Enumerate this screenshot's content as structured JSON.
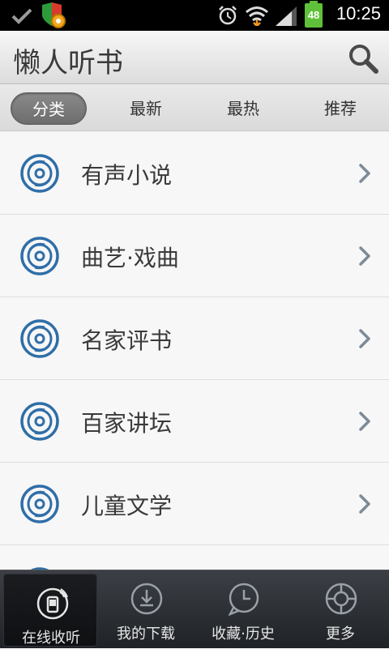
{
  "status_bar": {
    "time": "10:25",
    "battery": "48",
    "icons": [
      "check-icon",
      "shield-icon",
      "alarm-icon",
      "wifi-icon",
      "signal-icon",
      "battery-icon"
    ]
  },
  "header": {
    "title": "懒人听书",
    "search_icon": "search-icon"
  },
  "tabs": [
    {
      "label": "分类",
      "active": true
    },
    {
      "label": "最新",
      "active": false
    },
    {
      "label": "最热",
      "active": false
    },
    {
      "label": "推荐",
      "active": false
    }
  ],
  "categories": [
    {
      "label": "有声小说"
    },
    {
      "label": "曲艺·戏曲"
    },
    {
      "label": "名家评书"
    },
    {
      "label": "百家讲坛"
    },
    {
      "label": "儿童文学"
    }
  ],
  "bottom_nav": [
    {
      "label": "在线收听",
      "icon": "phone-radio-icon",
      "active": true
    },
    {
      "label": "我的下载",
      "icon": "download-icon",
      "active": false
    },
    {
      "label": "收藏·历史",
      "icon": "history-icon",
      "active": false
    },
    {
      "label": "更多",
      "icon": "more-icon",
      "active": false
    }
  ],
  "colors": {
    "accent": "#2f6ea8",
    "active_tab": "#6d6d6d",
    "bottom_bar": "#2a2d32"
  }
}
